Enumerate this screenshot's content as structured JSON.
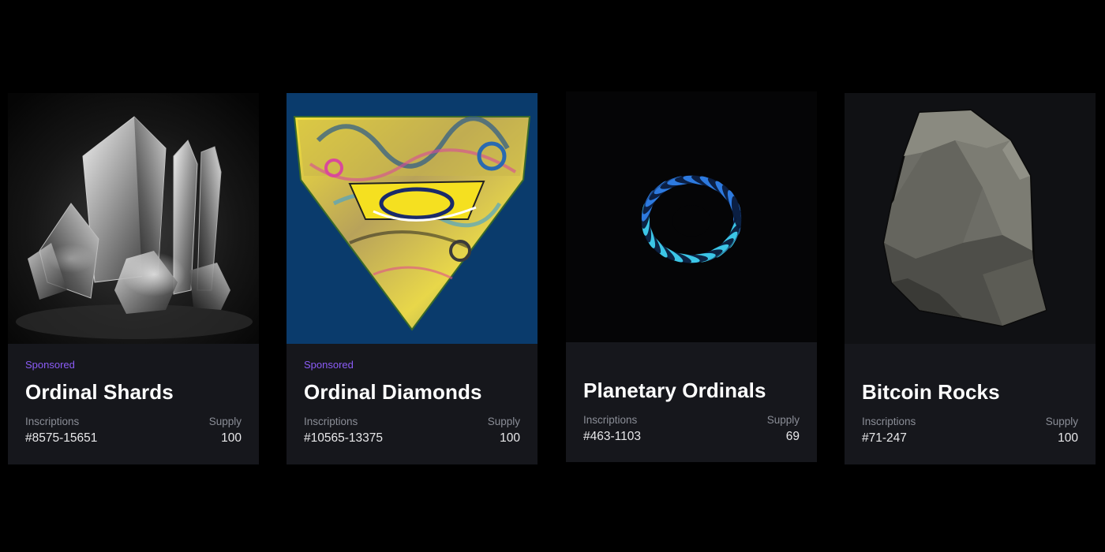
{
  "cards": [
    {
      "image": "crystal-shards-image",
      "badge": "Sponsored",
      "title": "Ordinal Shards",
      "inscriptions_label": "Inscriptions",
      "inscriptions_value": "#8575-15651",
      "supply_label": "Supply",
      "supply_value": "100"
    },
    {
      "image": "glitch-diamond-image",
      "badge": "Sponsored",
      "title": "Ordinal Diamonds",
      "inscriptions_label": "Inscriptions",
      "inscriptions_value": "#10565-13375",
      "supply_label": "Supply",
      "supply_value": "100"
    },
    {
      "image": "blue-torus-image",
      "title": "Planetary Ordinals",
      "inscriptions_label": "Inscriptions",
      "inscriptions_value": "#463-1103",
      "supply_label": "Supply",
      "supply_value": "69"
    },
    {
      "image": "grey-rock-image",
      "title": "Bitcoin Rocks",
      "inscriptions_label": "Inscriptions",
      "inscriptions_value": "#71-247",
      "supply_label": "Supply",
      "supply_value": "100"
    }
  ],
  "colors": {
    "page_background": "#000000",
    "card_background": "#16171c",
    "sponsored_accent": "#8b5cf6",
    "label_gray": "#8a8d96"
  }
}
